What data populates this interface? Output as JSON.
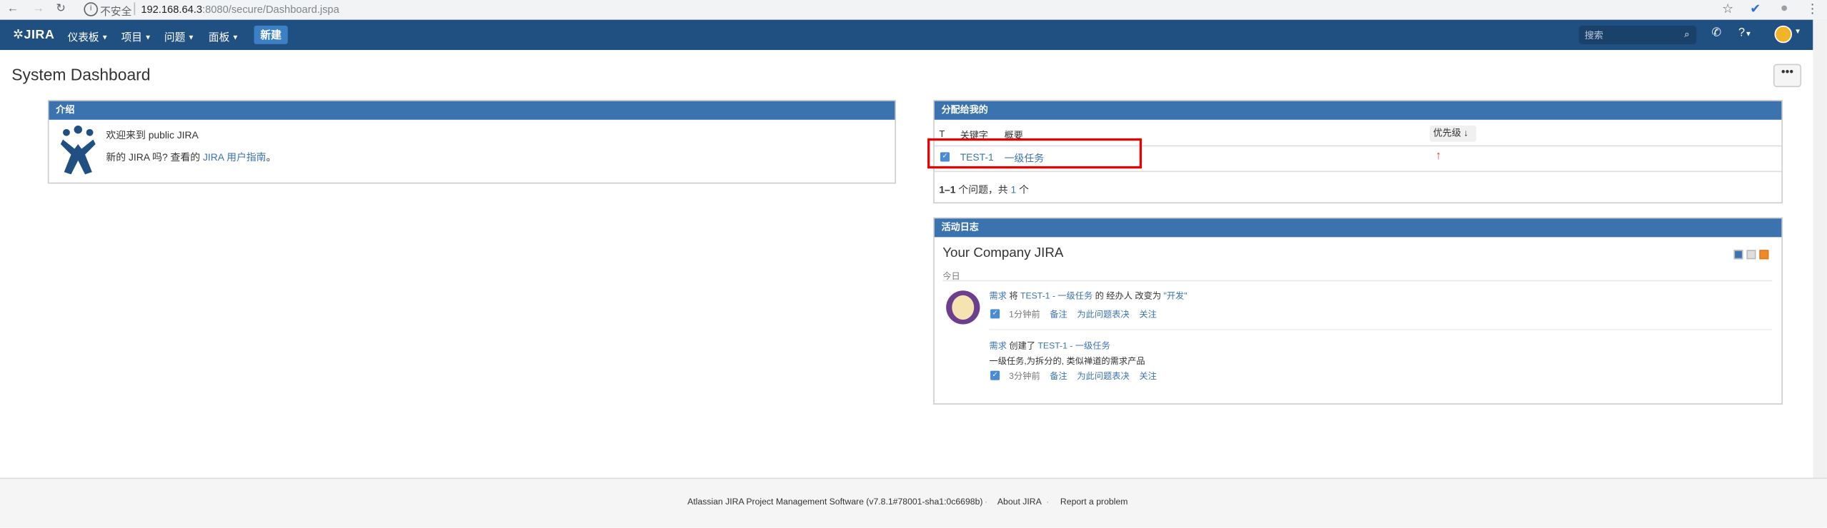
{
  "browser": {
    "insecure_label": "不安全",
    "url_host": "192.168.64.3",
    "url_rest": ":8080/secure/Dashboard.jspa"
  },
  "header": {
    "logo": "JIRA",
    "menus": [
      "仪表板",
      "项目",
      "问题",
      "面板"
    ],
    "create": "新建",
    "search_placeholder": "搜索"
  },
  "page": {
    "title": "System Dashboard",
    "more": "•••"
  },
  "intro": {
    "title": "介绍",
    "welcome": "欢迎来到 public JIRA",
    "new_prefix": "新的 JIRA 吗? 查看的",
    "guide_link": "JIRA 用户指南",
    "new_suffix": "。"
  },
  "assigned": {
    "title": "分配给我的",
    "columns": {
      "type": "T",
      "key": "关键字",
      "summary": "概要",
      "priority": "优先级"
    },
    "rows": [
      {
        "key": "TEST-1",
        "summary": "一级任务",
        "priority": "↑"
      }
    ],
    "count_range": "1–1",
    "count_mid": "个问题，共",
    "count_total": "1",
    "count_suffix": "个"
  },
  "activity": {
    "gadget_title": "活动日志",
    "stream_title": "Your Company JIRA",
    "today": "今日",
    "entry1": {
      "user": "需求",
      "verb": "将",
      "issue": "TEST-1 - 一级任务",
      "text": "的 经办人 改变为",
      "value": "\"开发\"",
      "time": "1分钟前",
      "a1": "备注",
      "a2": "为此问题表决",
      "a3": "关注"
    },
    "entry2": {
      "user": "需求",
      "verb": "创建了",
      "issue": "TEST-1 - 一级任务",
      "desc": "一级任务,为拆分的, 类似禅道的需求产品",
      "time": "3分钟前",
      "a1": "备注",
      "a2": "为此问题表决",
      "a3": "关注"
    }
  },
  "footer": {
    "software": "Atlassian JIRA Project Management Software (v7.8.1#78001-sha1:0c6698b)",
    "dot": "·",
    "about": "About JIRA",
    "report": "Report a problem"
  }
}
